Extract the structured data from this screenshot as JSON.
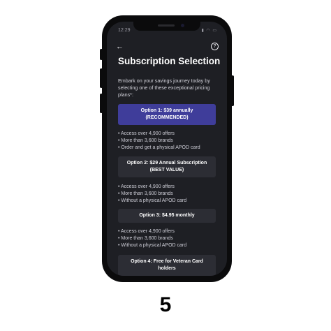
{
  "status_bar": {
    "time": "12:29",
    "icons": "▮ ◠ ▭"
  },
  "header": {
    "back_icon": "←",
    "help_icon": "?"
  },
  "title": "Subscription Selection",
  "intro": "Embark on your savings journey today by selecting one of these exceptional pricing plans*:",
  "options": [
    {
      "label_line1": "Option 1: $39 annually",
      "label_line2": "(RECOMMENDED)",
      "features": [
        "• Access over 4,900 offers",
        "• More than 3,600 brands",
        "• Order and get a physical APOD card"
      ]
    },
    {
      "label_line1": "Option 2: $29 Annual Subscription",
      "label_line2": "(BEST VALUE)",
      "features": [
        "• Access over 4,900 offers",
        "• More than 3,600 brands",
        "• Without a physical APOD card"
      ]
    },
    {
      "label_line1": "Option 3: $4.95 monthly",
      "features": [
        "• Access over 4,900 offers",
        "• More than 3,600 brands",
        "• Without a physical APOD card"
      ]
    },
    {
      "label_line1": "Option 4: Free for Veteran Card",
      "label_line2": "holders"
    }
  ],
  "colors": {
    "accent": "#3f3d9a",
    "screen_bg": "#1e1f24",
    "option_bg": "#2c2d34"
  },
  "page_number": "5"
}
